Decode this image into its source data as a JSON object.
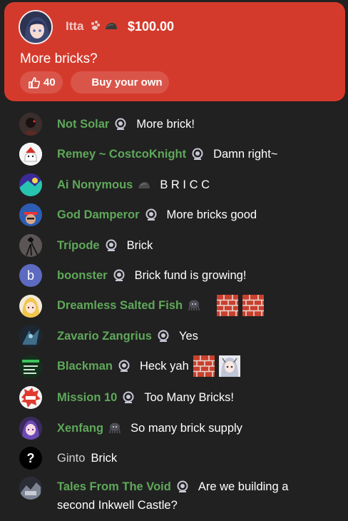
{
  "superchat": {
    "author": "Itta",
    "amount": "$100.00",
    "message": "More bricks?",
    "like_count": "40",
    "buy_label": "Buy your own",
    "color": "#d43a2c"
  },
  "messages": [
    {
      "author": "Not Solar",
      "text": "More brick!",
      "badge": "member-badge-icon"
    },
    {
      "author": "Remey ~ CostcoKnight",
      "text": "Damn right~",
      "badge": "member-badge-icon"
    },
    {
      "author": "Ai Nonymous",
      "text": "B R I C C",
      "badge": "rock-badge-icon"
    },
    {
      "author": "God Damperor",
      "text": "More bricks good",
      "badge": "member-badge-icon"
    },
    {
      "author": "Trípode",
      "text": "Brick",
      "badge": "member-badge-icon"
    },
    {
      "author": "boonster",
      "text": "Brick fund is growing!",
      "badge": "member-badge-icon",
      "avatar_letter": "b"
    },
    {
      "author": "Dreamless Salted Fish",
      "text": "",
      "badge": "octopus-badge-icon",
      "emotes": [
        "brick-emote-icon",
        "brick-emote-icon"
      ]
    },
    {
      "author": "Zavario Zangrius",
      "text": "Yes",
      "badge": "member-badge-icon"
    },
    {
      "author": "Blackman",
      "text": "Heck yah",
      "badge": "member-badge-icon",
      "emotes": [
        "brick-emote-icon",
        "face-emote-icon"
      ]
    },
    {
      "author": "Mission 10",
      "text": "Too Many Bricks!",
      "badge": "member-badge-icon"
    },
    {
      "author": "Xenfang",
      "text": "So many brick supply",
      "badge": "octopus-badge-icon"
    },
    {
      "author": "Ginto",
      "text": "Brick",
      "badge": "",
      "avatar_letter": "?"
    },
    {
      "author": "Tales From The Void",
      "text": "Are we building a",
      "text_line2": "second Inkwell Castle?",
      "badge": "member-badge-icon"
    }
  ],
  "colors": {
    "background": "#212121",
    "member_name": "#5fa85a",
    "plain_name": "#cfcfcf"
  }
}
